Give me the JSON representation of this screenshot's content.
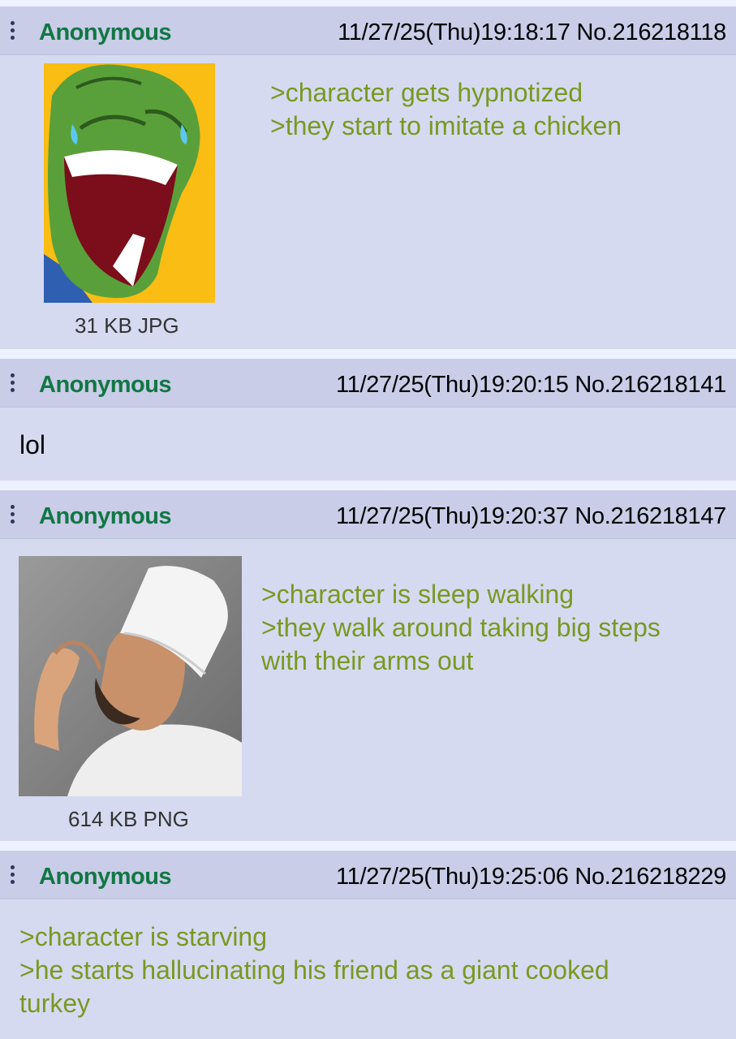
{
  "posts": [
    {
      "name": "Anonymous",
      "datetime": "11/27/25(Thu)19:18:17",
      "number": "No.216218118",
      "file_info": "31 KB JPG",
      "image": "laughing-frog-thumbnail",
      "lines": [
        ">character gets hypnotized",
        ">they start to imitate a chicken"
      ]
    },
    {
      "name": "Anonymous",
      "datetime": "11/27/25(Thu)19:20:15",
      "number": "No.216218141",
      "text": "lol"
    },
    {
      "name": "Anonymous",
      "datetime": "11/27/25(Thu)19:20:37",
      "number": "No.216218147",
      "file_info": "614 KB PNG",
      "image": "chef-kiss-thumbnail",
      "lines": [
        ">character is sleep walking",
        ">they walk around taking big steps\nwith their arms out"
      ]
    },
    {
      "name": "Anonymous",
      "datetime": "11/27/25(Thu)19:25:06",
      "number": "No.216218229",
      "lines": [
        ">character is starving",
        ">he starts hallucinating his friend as a giant cooked\nturkey"
      ]
    }
  ],
  "colors": {
    "name": "#117743",
    "greentext": "#789922",
    "post_bg": "#d6daf0",
    "header_bg": "#c9cde8",
    "page_bg": "#eef2ff"
  }
}
